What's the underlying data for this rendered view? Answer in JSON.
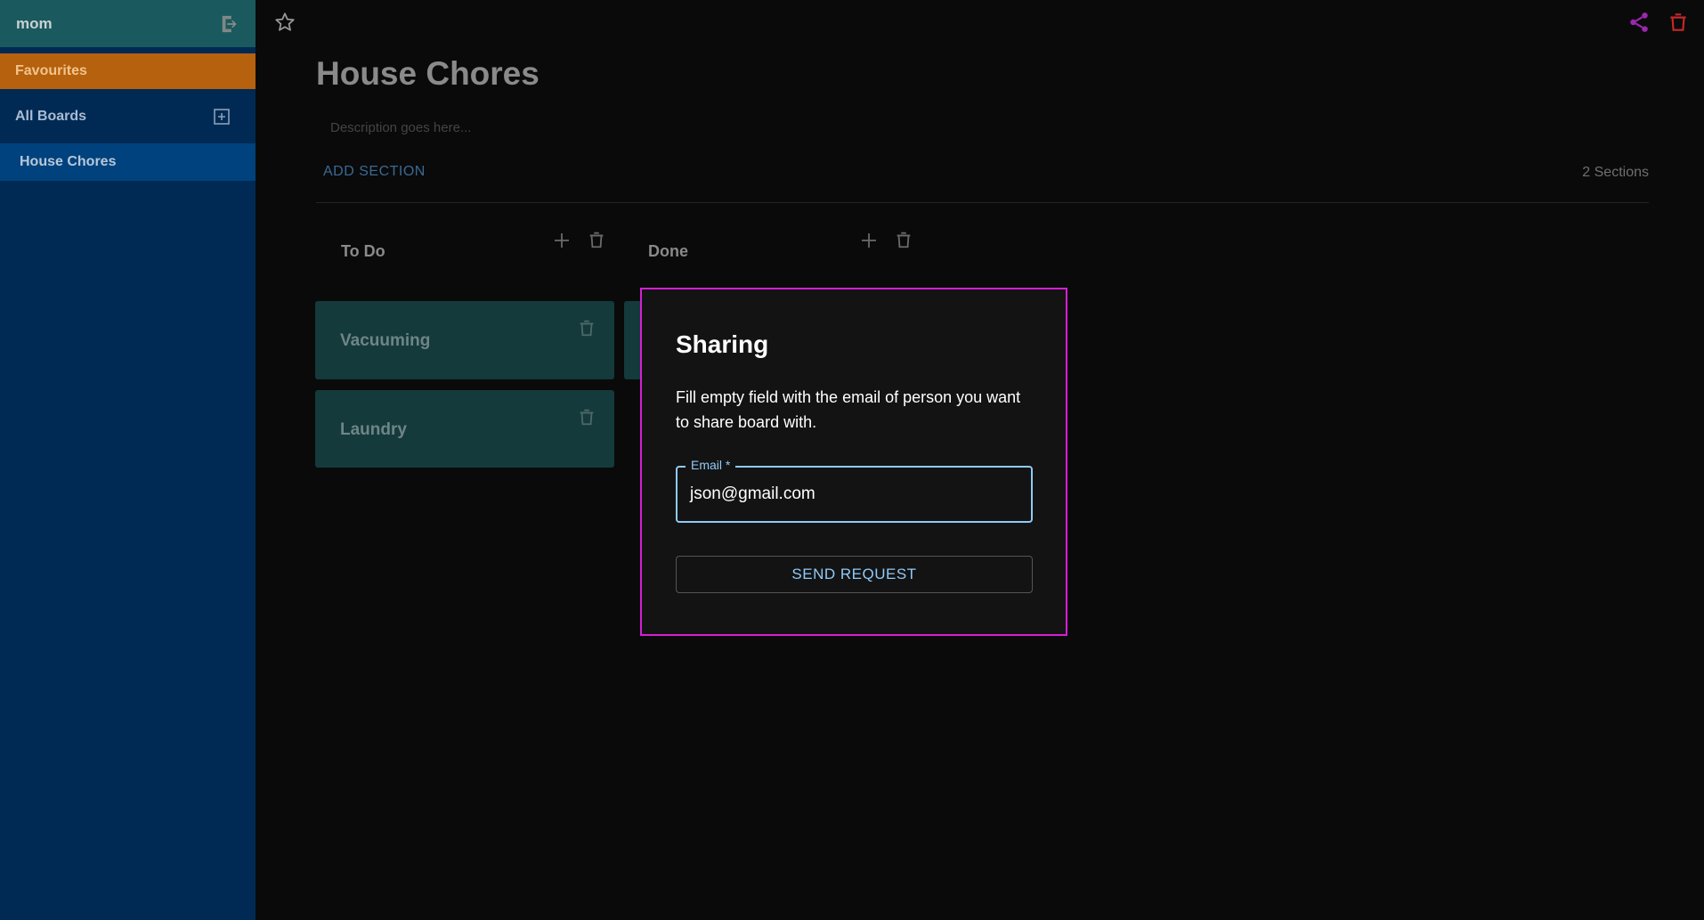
{
  "sidebar": {
    "user_name": "mom",
    "favourites_label": "Favourites",
    "all_boards_label": "All Boards",
    "boards": [
      {
        "label": "House Chores"
      }
    ]
  },
  "board": {
    "title": "House Chores",
    "description_placeholder": "Description goes here...",
    "add_section_label": "ADD SECTION",
    "sections_count": "2 Sections",
    "sections": [
      {
        "title": "To Do",
        "tasks": [
          "Vacuuming",
          "Laundry"
        ]
      },
      {
        "title": "Done",
        "tasks": []
      }
    ]
  },
  "modal": {
    "title": "Sharing",
    "message": "Fill empty field with the email of person you want to share board with.",
    "email_label": "Email *",
    "email_value": "json@gmail.com",
    "send_label": "SEND REQUEST"
  },
  "colors": {
    "accent": "#90caf9",
    "modal_border": "#d61fd6",
    "share_icon": "#9c27b0",
    "delete_icon": "#c62828",
    "favourites_bg": "#b5610d",
    "sidebar_bg": "#002a54"
  },
  "icons": [
    "logout-icon",
    "add-box-icon",
    "star-outline-icon",
    "share-icon",
    "delete-icon",
    "plus-icon"
  ]
}
